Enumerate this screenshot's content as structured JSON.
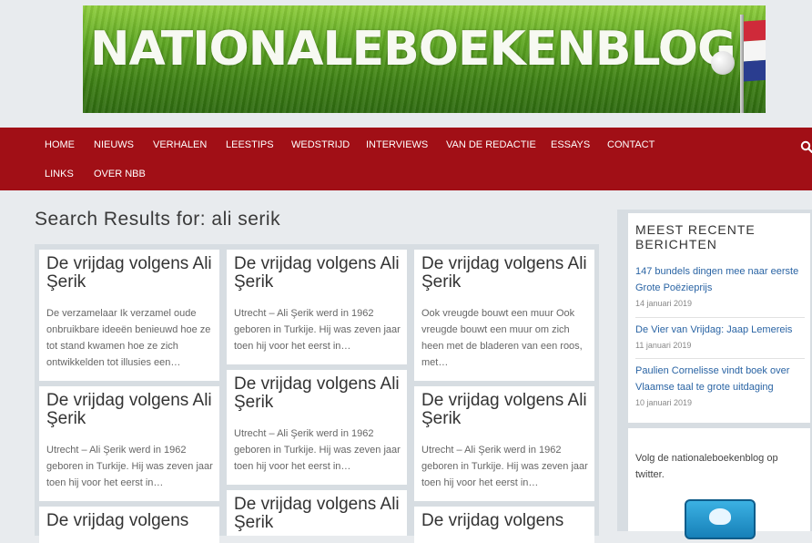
{
  "header": {
    "site_name": "NATIONALEBOEKENBLOG"
  },
  "nav": {
    "items": [
      "HOME",
      "NIEUWS",
      "VERHALEN",
      "LEESTIPS",
      "WEDSTRIJD",
      "INTERVIEWS",
      "VAN DE REDACTIE",
      "ESSAYS",
      "CONTACT",
      "LINKS",
      "OVER NBB"
    ]
  },
  "main": {
    "title": "Search Results for: ali serik",
    "cards": [
      {
        "title": "De vrijdag volgens Ali Şerik",
        "excerpt": "De verzamelaar Ik verzamel oude onbruikbare ideeën benieuwd hoe ze tot stand kwamen hoe ze zich ontwikkelden tot illusies een…"
      },
      {
        "title": "De vrijdag volgens Ali Şerik",
        "excerpt": "Utrecht – Ali Şerik werd in 1962 geboren in Turkije. Hij was zeven jaar toen hij voor het eerst in…"
      },
      {
        "title": "De vrijdag volgens Ali Şerik",
        "excerpt": "Ook vreugde bouwt een muur Ook vreugde bouwt een muur om zich heen met de bladeren van een roos, met…"
      },
      {
        "title": "De vrijdag volgens Ali Şerik",
        "excerpt": "Utrecht – Ali Şerik werd in 1962 geboren in Turkije. Hij was zeven jaar toen hij voor het eerst in…"
      },
      {
        "title": "De vrijdag volgens Ali Şerik",
        "excerpt": "Utrecht – Ali Şerik werd in 1962 geboren in Turkije. Hij was zeven jaar toen hij voor het eerst in…"
      },
      {
        "title": "De vrijdag volgens Ali Şerik",
        "excerpt": "Utrecht – Ali Şerik werd in 1962 geboren in Turkije. Hij was zeven jaar toen hij voor het eerst in…"
      },
      {
        "title": "De vrijdag volgens",
        "excerpt": ""
      },
      {
        "title": "De vrijdag volgens Ali Şerik",
        "excerpt": ""
      },
      {
        "title": "De vrijdag volgens",
        "excerpt": ""
      }
    ]
  },
  "sidebar": {
    "recent_title": "MEEST RECENTE BERICHTEN",
    "posts": [
      {
        "title": "147 bundels dingen mee naar eerste Grote Poëzieprijs",
        "date": "14 januari 2019"
      },
      {
        "title": "De Vier van Vrijdag: Jaap Lemereis",
        "date": "11 januari 2019"
      },
      {
        "title": "Paulien Cornelisse vindt boek over Vlaamse taal te grote uitdaging",
        "date": "10 januari 2019"
      }
    ],
    "twitter_text": "Volg de nationaleboekenblog op twitter."
  },
  "colors": {
    "nav_bg": "#a10f16",
    "link": "#2a64a4",
    "page_bg": "#e8ebee"
  },
  "icons": {
    "search": "search-icon",
    "twitter": "twitter-bird-icon"
  }
}
